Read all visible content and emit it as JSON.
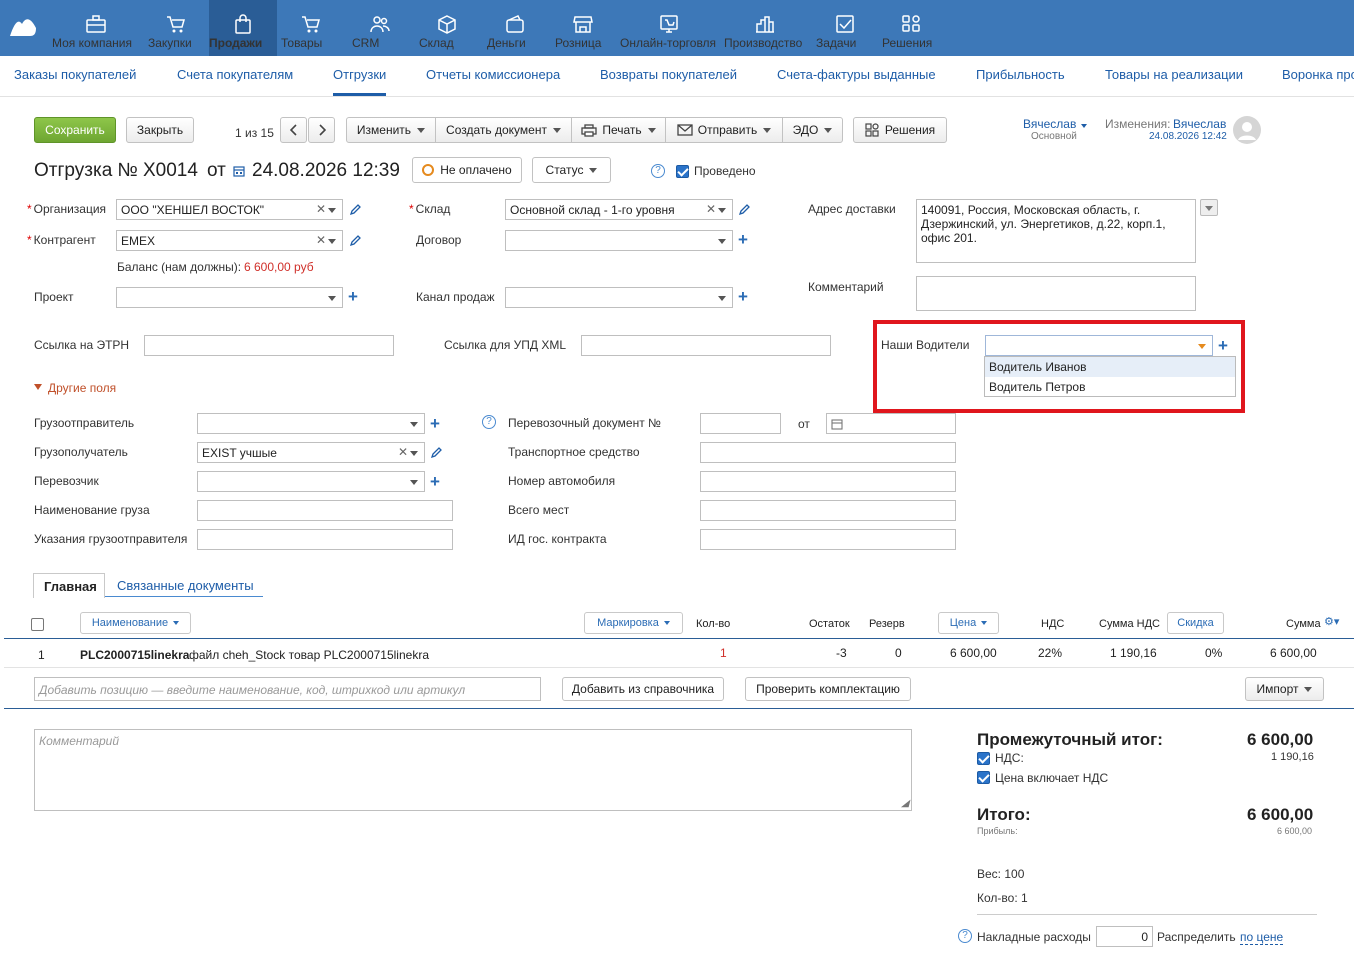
{
  "nav": {
    "items": [
      {
        "label": "Моя компания",
        "icon": "briefcase-icon"
      },
      {
        "label": "Закупки",
        "icon": "cart-in-icon"
      },
      {
        "label": "Продажи",
        "icon": "bag-icon"
      },
      {
        "label": "Товары",
        "icon": "cart-icon"
      },
      {
        "label": "CRM",
        "icon": "people-icon"
      },
      {
        "label": "Склад",
        "icon": "box-icon"
      },
      {
        "label": "Деньги",
        "icon": "wallet-icon"
      },
      {
        "label": "Розница",
        "icon": "shop-icon"
      },
      {
        "label": "Онлайн-торговля",
        "icon": "online-store-icon"
      },
      {
        "label": "Производство",
        "icon": "factory-icon"
      },
      {
        "label": "Задачи",
        "icon": "task-check-icon"
      },
      {
        "label": "Решения",
        "icon": "apps-grid-icon"
      }
    ]
  },
  "subnav": {
    "items": [
      "Заказы покупателей",
      "Счета покупателям",
      "Отгрузки",
      "Отчеты комиссионера",
      "Возвраты покупателей",
      "Счета-фактуры выданные",
      "Прибыльность",
      "Товары на реализации",
      "Воронка продаж"
    ]
  },
  "toolbar": {
    "save": "Сохранить",
    "close": "Закрыть",
    "pager": "1 из 15",
    "edit": "Изменить",
    "create_doc": "Создать документ",
    "print": "Печать",
    "send": "Отправить",
    "edo": "ЭДО",
    "solutions": "Решения"
  },
  "user": {
    "name": "Вячеслав",
    "role": "Основной",
    "changes_label": "Изменения:",
    "changes_user": "Вячеслав",
    "changes_date": "24.08.2026 12:42"
  },
  "doc": {
    "title_prefix": "Отгрузка №",
    "number": "X0014",
    "from": "от",
    "date": "24.08.2026 12:39",
    "payment_status": "Не оплачено",
    "status_btn": "Статус",
    "posted": "Проведено"
  },
  "form": {
    "org_label": "Организация",
    "org_value": "ООО \"ХЕНШЕЛ ВОСТОК\"",
    "contractor_label": "Контрагент",
    "contractor_value": "EMEX",
    "balance_label": "Баланс (нам должны):",
    "balance_value": "6 600,00 руб",
    "project_label": "Проект",
    "warehouse_label": "Склад",
    "warehouse_value": "Основной склад - 1-го уровня",
    "contract_label": "Договор",
    "channel_label": "Канал продаж",
    "address_label": "Адрес доставки",
    "address_value": "140091, Россия, Московская область, г. Дзержинский,  ул. Энергетиков, д.22, корп.1, офис 201.",
    "comment_label": "Комментарий",
    "etrn_label": "Ссылка на ЭТРН",
    "upd_label": "Ссылка для УПД XML",
    "drivers_label": "Наши Водители",
    "drivers_options": [
      "Водитель Иванов",
      "Водитель Петров"
    ],
    "other_fields": "Другие поля",
    "shipper_label": "Грузоотправитель",
    "consignee_label": "Грузополучатель",
    "consignee_value": "EXIST учшые",
    "carrier_label": "Перевозчик",
    "cargo_name_label": "Наименование груза",
    "shipper_notes_label": "Указания грузоотправителя",
    "transport_doc_label": "Перевозочный документ №",
    "transport_doc_from": "от",
    "vehicle_label": "Транспортное средство",
    "car_number_label": "Номер автомобиля",
    "places_label": "Всего мест",
    "gov_contract_label": "ИД гос. контракта"
  },
  "tabs": {
    "main": "Главная",
    "linked": "Связанные документы"
  },
  "table": {
    "headers": {
      "name": "Наименование",
      "marking": "Маркировка",
      "qty": "Кол-во",
      "stock": "Остаток",
      "reserve": "Резерв",
      "price": "Цена",
      "vat": "НДС",
      "vat_sum": "Сумма НДС",
      "discount": "Скидка",
      "sum": "Сумма"
    },
    "rows": [
      {
        "n": "1",
        "code": "PLC2000715linekra",
        "desc": " файл cheh_Stock товар PLC2000715linekra",
        "qty": "1",
        "stock": "-3",
        "reserve": "0",
        "price": "6 600,00",
        "vat": "22%",
        "vat_sum": "1 190,16",
        "discount": "0%",
        "sum": "6 600,00"
      }
    ],
    "add_placeholder": "Добавить позицию — введите наименование, код, штрихкод или артикул",
    "add_from_catalog": "Добавить из справочника",
    "check_kit": "Проверить комплектацию",
    "import": "Импорт"
  },
  "comment_placeholder": "Комментарий",
  "totals": {
    "subtotal_label": "Промежуточный итог:",
    "subtotal": "6 600,00",
    "vat_label": "НДС:",
    "vat": "1 190,16",
    "price_incl_vat": "Цена включает НДС",
    "total_label": "Итого:",
    "total": "6 600,00",
    "profit_label": "Прибыль:",
    "profit": "6 600,00",
    "weight": "Вес: 100",
    "qty": "Кол-во: 1",
    "overhead_label": "Накладные расходы",
    "overhead_value": "0",
    "distribute_label": "Распределить",
    "distribute_link": "по цене"
  },
  "colors": {
    "nav_bg": "#3d78b8",
    "nav_active": "#2a5d96",
    "accent": "#1e5da8",
    "highlight": "#e0161d",
    "save_green": "#7ab53b"
  }
}
